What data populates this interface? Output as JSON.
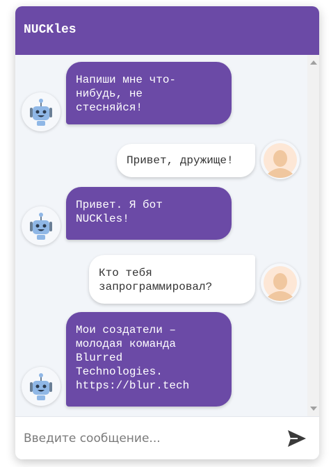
{
  "header": {
    "title": "NUCKles"
  },
  "messages": [
    {
      "sender": "bot",
      "text": "Напиши мне что-\nнибудь, не\nстесняйся!"
    },
    {
      "sender": "user",
      "text": "Привет, дружище!"
    },
    {
      "sender": "bot",
      "text": "Привет. Я бот\nNUCKles!"
    },
    {
      "sender": "user",
      "text": "Кто тебя\nзапрограммировал?"
    },
    {
      "sender": "bot",
      "text": "Мои создатели –\nмолодая команда\nBlurred\nTechnologies.\nhttps://blur.tech"
    }
  ],
  "composer": {
    "placeholder": "Введите сообщение..."
  },
  "icons": {
    "bot_avatar": "robot-icon",
    "user_avatar": "person-icon",
    "send": "send-icon"
  },
  "colors": {
    "accent": "#6b4aa6",
    "background": "#f2f5f9"
  }
}
